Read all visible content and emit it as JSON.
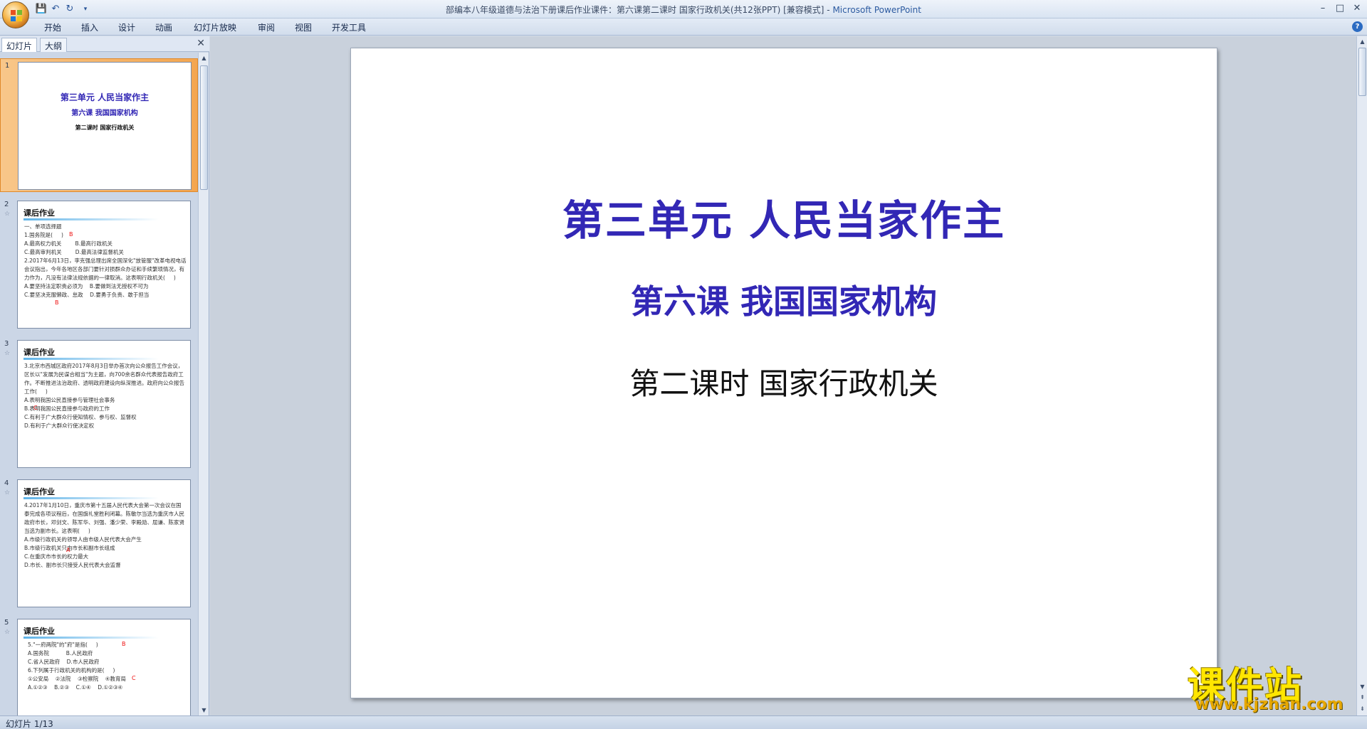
{
  "window": {
    "title": "部编本八年级道德与法治下册课后作业课件：第六课第二课时 国家行政机关(共12张PPT) [兼容模式]",
    "app_name": "Microsoft PowerPoint",
    "separator": " - "
  },
  "qat": {
    "save": "💾",
    "undo": "↶",
    "redo": "↻",
    "more": "▾"
  },
  "window_controls": {
    "minimize": "–",
    "maximize": "□",
    "close": "✕"
  },
  "ribbon_tabs": [
    "开始",
    "插入",
    "设计",
    "动画",
    "幻灯片放映",
    "审阅",
    "视图",
    "开发工具"
  ],
  "help_label": "?",
  "pane": {
    "tabs": [
      "幻灯片",
      "大纲"
    ],
    "close": "✕"
  },
  "thumbnails": [
    {
      "num": "1",
      "title": "第三单元  人民当家作主",
      "subtitle": "第六课  我国国家机构",
      "sub2": "第二课时    国家行政机关"
    },
    {
      "num": "2",
      "star": "☆",
      "title": "课后作业",
      "body": "一、单项选择题\n1.国务院是(     )\nA.最高权力机关        B.最高行政机关\nC.最高审判机关        D.最高法律监督机关\n2.2017年6月13日，李克强总理出席全国深化\"放管服\"改革电视电话会议指出，今年各地区各部门要针对损群众办证和手续繁琐情况，有力作为，凡没有法律法规依据的一律取消。这表明行政机关(     )\nA.要坚持法定职责必须为    B.要做到法无授权不可为\nC.要坚决克服懒政、怠政    D.要勇于负责、敢于担当",
      "mark1": "B",
      "mark2": "B"
    },
    {
      "num": "3",
      "star": "☆",
      "title": "课后作业",
      "body": "3.北京市西城区政府2017年8月3日举办首次向公众报告工作会议，区长以\"发展为民谋合相当\"为主题，向700余名群众代表报告政府工作。不断推进法治政府、透明政府建设向纵深推进。政府向公众报告工作(     )\nA.表明我国公民直接参与管理社会事务\nB.表明我国公民直接参与政府的工作\nC.有利于广大群众行使知情权、参与权、监督权\nD.有利于广大群众行使决定权",
      "mark1": "C"
    },
    {
      "num": "4",
      "star": "☆",
      "title": "课后作业",
      "body": "4.2017年1月10日，重庆市第十五届人民代表大会第一次会议在国泰完成各项议程后，在国旗礼堂胜利闭幕。陈敏尔当选为重庆市人民政府市长，邓剑文、陈军华、刘强、潘少荣、李殿勋、屈谦、陈家贤当选为副市长。这表明(     )\nA.市级行政机关的领导人由市级人民代表大会产生\nB.市级行政机关只由市长和副市长组成\nC.在重庆市市长的权力最大\nD.市长、副市长只接受人民代表大会监督",
      "mark1": "A"
    },
    {
      "num": "5",
      "star": "☆",
      "title": "课后作业",
      "body": "5.\"一府两院\"的\"府\"是指(     )\nA.国务院          B.人民政府\nC.省人民政府    D.市人民政府\n6.下列属于行政机关的机构的是(     )\n①公安局    ②法院    ③检察院    ④教育局\nA.①②③    B.②③    C.①④    D.①②③④",
      "mark1": "B",
      "mark2": "C"
    }
  ],
  "slide": {
    "title": "第三单元  人民当家作主",
    "subtitle": "第六课  我国国家机构",
    "sub2": "第二课时    国家行政机关"
  },
  "scroll": {
    "up": "▲",
    "down": "▼",
    "prev": "⇞",
    "next": "⇟"
  },
  "watermark": {
    "text": "课件站",
    "url": "www.kjzhan.com"
  },
  "status": {
    "slide_indicator": "幻灯片 1/13"
  },
  "colors": {
    "slide_title": "#3227b5",
    "selected_thumb": "#f4a650",
    "watermark": "#ffe600"
  }
}
